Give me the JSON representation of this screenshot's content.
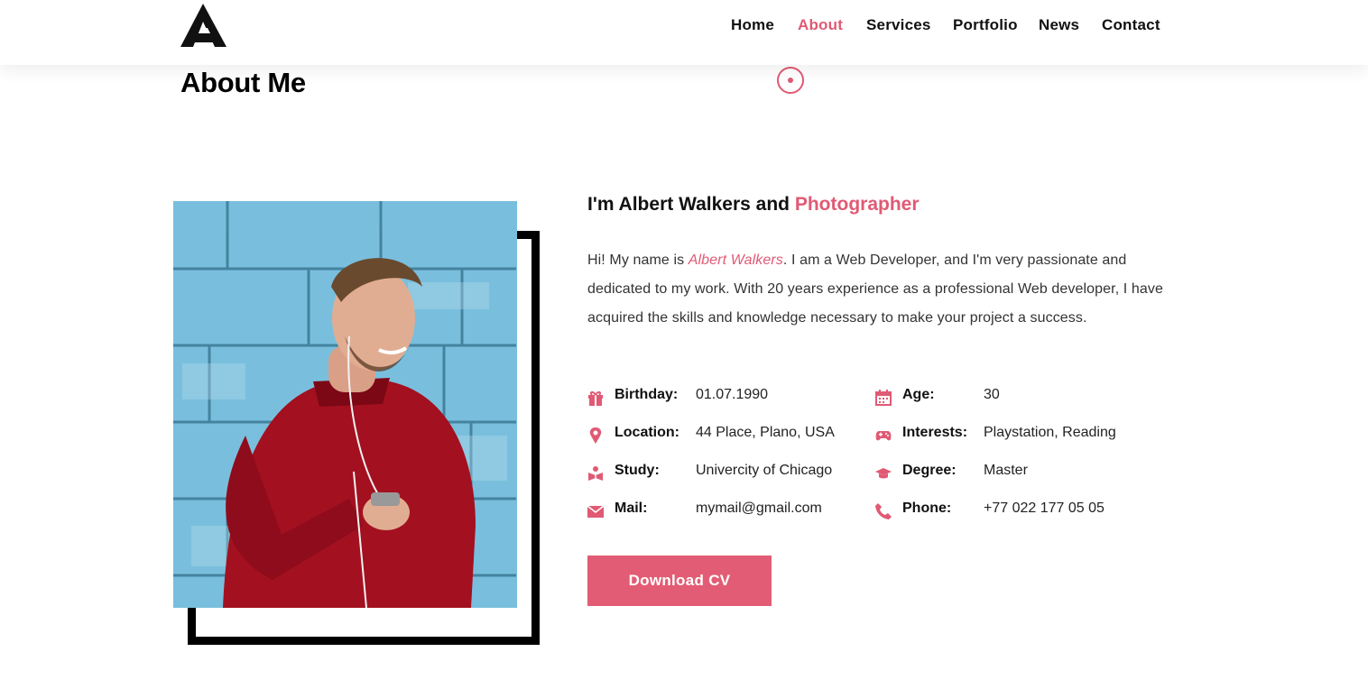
{
  "nav": {
    "items": [
      {
        "label": "Home"
      },
      {
        "label": "About"
      },
      {
        "label": "Services"
      },
      {
        "label": "Portfolio"
      },
      {
        "label": "News"
      },
      {
        "label": "Contact"
      }
    ],
    "active": "About"
  },
  "page_title": "About Me",
  "profile": {
    "headline_prefix": "I'm Albert Walkers and ",
    "headline_accent": "Photographer",
    "bio_before": "Hi! My name is ",
    "bio_name": "Albert Walkers",
    "bio_after": ". I am a Web Developer, and I'm very passionate and dedicated to my work. With 20 years experience as a professional Web developer, I have acquired the skills and knowledge necessary to make your project a success."
  },
  "info": {
    "left": [
      {
        "icon": "gift-icon",
        "label": "Birthday:",
        "value": "01.07.1990"
      },
      {
        "icon": "map-pin-icon",
        "label": "Location:",
        "value": "44 Place, Plano, USA"
      },
      {
        "icon": "study-icon",
        "label": "Study:",
        "value": "Univercity of Chicago"
      },
      {
        "icon": "envelope-icon",
        "label": "Mail:",
        "value": "mymail@gmail.com"
      }
    ],
    "right": [
      {
        "icon": "calendar-icon",
        "label": "Age:",
        "value": "30"
      },
      {
        "icon": "gamepad-icon",
        "label": "Interests:",
        "value": "Playstation, Reading"
      },
      {
        "icon": "graduation-cap-icon",
        "label": "Degree:",
        "value": "Master"
      },
      {
        "icon": "phone-icon",
        "label": "Phone:",
        "value": "+77 022 177 05 05"
      }
    ]
  },
  "cta": {
    "label": "Download CV"
  },
  "colors": {
    "accent": "#e05a74",
    "button": "#e35c75",
    "text": "#111111"
  }
}
